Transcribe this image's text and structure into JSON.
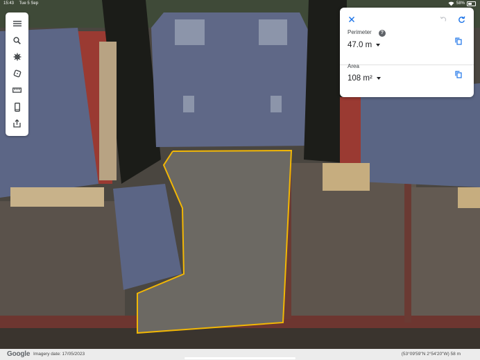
{
  "status_bar": {
    "time": "15:43",
    "date": "Tue 5 Sep",
    "battery_percent": "58%"
  },
  "toolbar": {
    "items": [
      {
        "name": "menu-button",
        "icon": "hamburger-icon"
      },
      {
        "name": "search-button",
        "icon": "search-icon"
      },
      {
        "name": "voyager-button",
        "icon": "helm-icon"
      },
      {
        "name": "feeling-lucky-button",
        "icon": "dice-icon"
      },
      {
        "name": "measure-button",
        "icon": "ruler-icon"
      },
      {
        "name": "projects-button",
        "icon": "device-icon"
      },
      {
        "name": "share-button",
        "icon": "share-icon"
      }
    ]
  },
  "measure_panel": {
    "perimeter_label": "Perimeter",
    "perimeter_value": "47.0 m",
    "area_label": "Area",
    "area_value": "108 m²",
    "accent_color": "#1a73e8"
  },
  "bottom_bar": {
    "logo": "Google",
    "imagery_date": "Imagery date: 17/05/2023",
    "coordinates": "(53°09'59\"N 2°54'20\"W) 58 m"
  }
}
